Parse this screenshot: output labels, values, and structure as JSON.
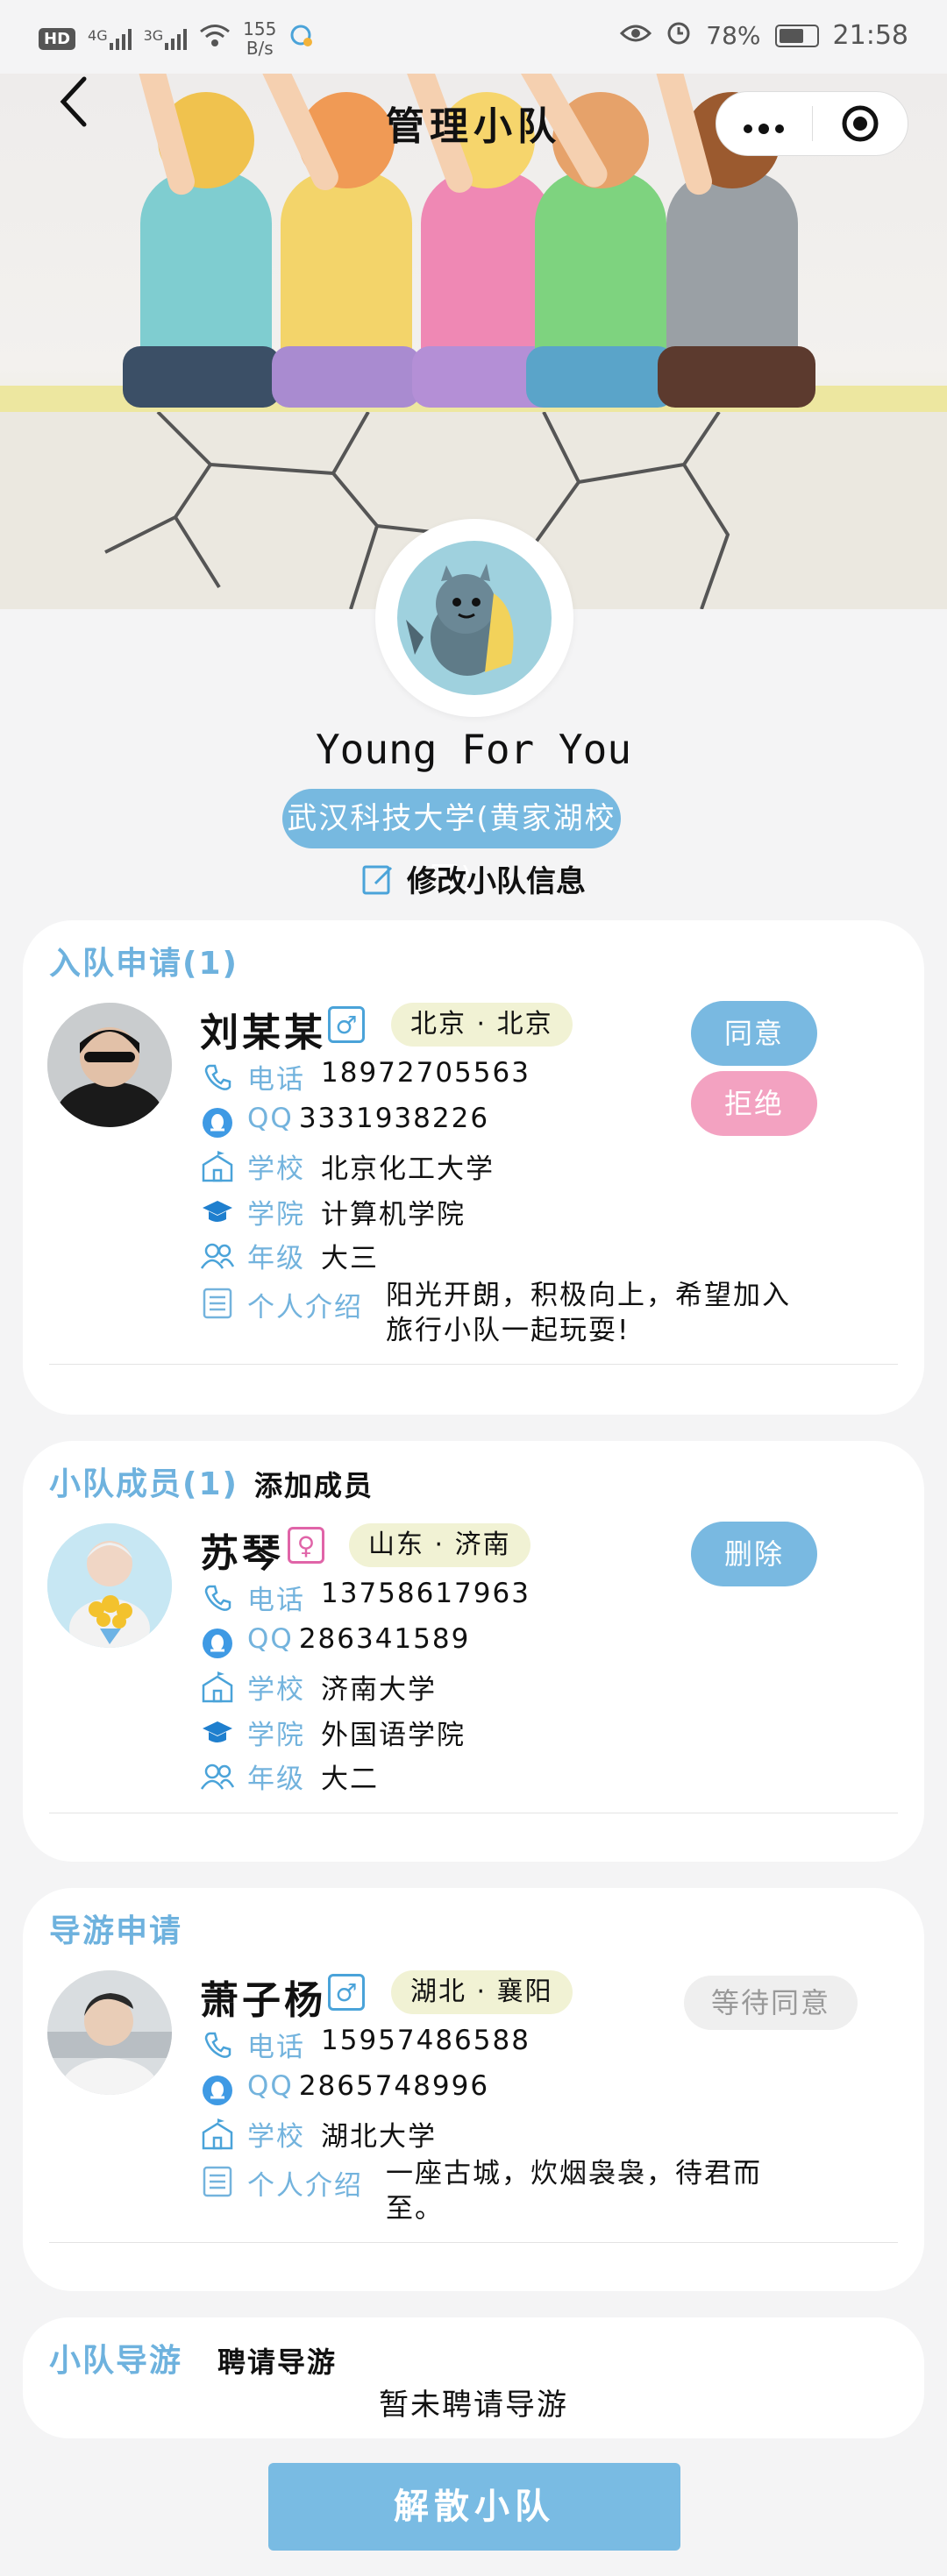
{
  "status_bar": {
    "hd": "HD",
    "net1": "4G",
    "net2": "3G",
    "speed_value": "155",
    "speed_unit": "B/s",
    "battery": "78%",
    "time": "21:58"
  },
  "nav": {
    "title": "管理小队"
  },
  "team": {
    "name": "Young For You",
    "school": "武汉科技大学(黄家湖校区)",
    "edit_label": "修改小队信息"
  },
  "applications": {
    "title": "入队申请(1)",
    "items": [
      {
        "name": "刘某某",
        "gender": "male",
        "gender_symbol": "♂",
        "location": "北京 · 北京",
        "phone_label": "电话",
        "phone": "18972705563",
        "qq_label": "QQ",
        "qq": "3331938226",
        "school_label": "学校",
        "school": "北京化工大学",
        "college_label": "学院",
        "college": "计算机学院",
        "grade_label": "年级",
        "grade": "大三",
        "intro_label": "个人介绍",
        "intro": "阳光开朗，积极向上，希望加入旅行小队一起玩耍!",
        "agree": "同意",
        "reject": "拒绝"
      }
    ]
  },
  "members": {
    "title": "小队成员(1)",
    "add_label": "添加成员",
    "items": [
      {
        "name": "苏琴",
        "gender": "female",
        "gender_symbol": "♀",
        "location": "山东 · 济南",
        "phone_label": "电话",
        "phone": "13758617963",
        "qq_label": "QQ",
        "qq": "286341589",
        "school_label": "学校",
        "school": "济南大学",
        "college_label": "学院",
        "college": "外国语学院",
        "grade_label": "年级",
        "grade": "大二",
        "delete": "删除"
      }
    ]
  },
  "guide_applications": {
    "title": "导游申请",
    "items": [
      {
        "name": "萧子杨",
        "gender": "male",
        "gender_symbol": "♂",
        "location": "湖北 · 襄阳",
        "phone_label": "电话",
        "phone": "15957486588",
        "qq_label": "QQ",
        "qq": "2865748996",
        "school_label": "学校",
        "school": "湖北大学",
        "intro_label": "个人介绍",
        "intro": "一座古城，炊烟袅袅，待君而至。",
        "status": "等待同意"
      }
    ]
  },
  "team_guide": {
    "title": "小队导游",
    "hire_label": "聘请导游",
    "empty_text": "暂未聘请导游"
  },
  "footer": {
    "dissolve": "解散小队"
  },
  "icons": {
    "phone": "phone-icon",
    "qq": "qq-icon",
    "school": "school-icon",
    "college": "graduation-cap-icon",
    "grade": "people-icon",
    "intro": "list-icon"
  },
  "colors": {
    "accent": "#79b9e1",
    "label_blue": "#73b3dd",
    "reject_pink": "#f3a2c1",
    "location_bg": "#f1f2d4"
  }
}
